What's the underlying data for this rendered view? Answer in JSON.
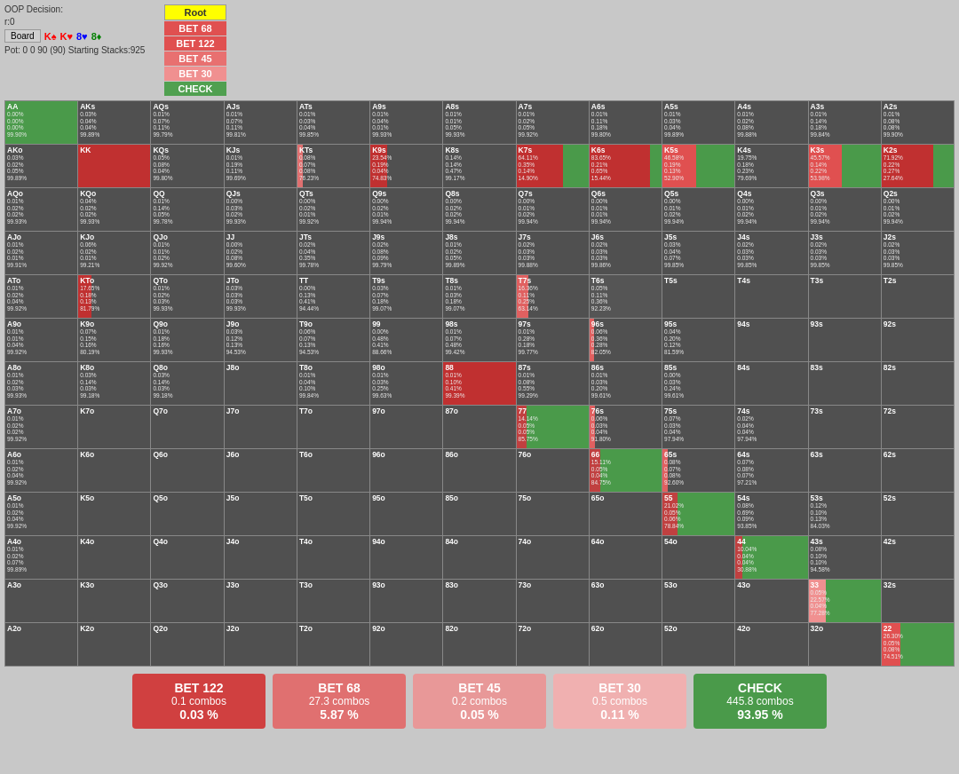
{
  "header": {
    "oop_decision": "OOP Decision:",
    "r": "r:0",
    "board_label": "Board",
    "cards": [
      "K♠",
      "K♥",
      "8♥",
      "8♦"
    ],
    "pot": "Pot: 0 0 90 (90) Starting Stacks:925"
  },
  "actions": [
    {
      "label": "Root",
      "class": "btn-root"
    },
    {
      "label": "BET 68",
      "class": "btn-bet68"
    },
    {
      "label": "BET 122",
      "class": "btn-bet122"
    },
    {
      "label": "BET 45",
      "class": "btn-bet45"
    },
    {
      "label": "BET 30",
      "class": "btn-bet30"
    },
    {
      "label": "CHECK",
      "class": "btn-check"
    }
  ],
  "summary": [
    {
      "label": "BET 122",
      "combos": "0.1 combos",
      "pct": "0.03 %",
      "class": "sum-red"
    },
    {
      "label": "BET 68",
      "combos": "27.3 combos",
      "pct": "5.87 %",
      "class": "sum-pink"
    },
    {
      "label": "BET 45",
      "combos": "0.2 combos",
      "pct": "0.05 %",
      "class": "sum-lpink"
    },
    {
      "label": "BET 30",
      "combos": "0.5 combos",
      "pct": "0.11 %",
      "class": "sum-vlpink"
    },
    {
      "label": "CHECK",
      "combos": "445.8 combos",
      "pct": "93.95 %",
      "class": "sum-green"
    }
  ],
  "grid_rows": [
    [
      "AA",
      "AKs",
      "AQs",
      "AJs",
      "ATs",
      "A9s",
      "A8s",
      "A7s",
      "A6s",
      "A5s",
      "A4s",
      "A3s",
      "A2s"
    ],
    [
      "AKo",
      "KK",
      "KQs",
      "KJs",
      "KTs",
      "K9s",
      "K8s",
      "K7s",
      "K6s",
      "K5s",
      "K4s",
      "K3s",
      "K2s"
    ],
    [
      "AQo",
      "KQo",
      "QQ",
      "QJs",
      "QTs",
      "Q9s",
      "Q8s",
      "Q7s",
      "Q6s",
      "Q5s",
      "Q4s",
      "Q3s",
      "Q2s"
    ],
    [
      "AJo",
      "KJo",
      "QJo",
      "JJ",
      "JTs",
      "J9s",
      "J8s",
      "J7s",
      "J6s",
      "J5s",
      "J4s",
      "J3s",
      "J2s"
    ],
    [
      "ATo",
      "KTo",
      "QTo",
      "JTo",
      "TT",
      "T9s",
      "T8s",
      "T7s",
      "T6s",
      "T5s",
      "T4s",
      "T3s",
      "T2s"
    ],
    [
      "A9o",
      "K9o",
      "Q9o",
      "J9o",
      "T9o",
      "99",
      "98s",
      "97s",
      "96s",
      "95s",
      "94s",
      "93s",
      "92s"
    ],
    [
      "A8o",
      "K8o",
      "Q8o",
      "J8o",
      "T8o",
      "98o",
      "88",
      "87s",
      "86s",
      "85s",
      "84s",
      "83s",
      "82s"
    ],
    [
      "A7o",
      "K7o",
      "Q7o",
      "J7o",
      "T7o",
      "97o",
      "87o",
      "77",
      "76s",
      "75s",
      "74s",
      "73s",
      "72s"
    ],
    [
      "A6o",
      "K6o",
      "Q6o",
      "J6o",
      "T6o",
      "96o",
      "86o",
      "76o",
      "66",
      "65s",
      "64s",
      "63s",
      "62s"
    ],
    [
      "A5o",
      "K5o",
      "Q5o",
      "J5o",
      "T5o",
      "95o",
      "85o",
      "75o",
      "65o",
      "55",
      "54s",
      "53s",
      "52s"
    ],
    [
      "A4o",
      "K4o",
      "Q4o",
      "J4o",
      "T4o",
      "94o",
      "84o",
      "74o",
      "64o",
      "54o",
      "44",
      "43s",
      "42s"
    ],
    [
      "A3o",
      "K3o",
      "Q3o",
      "J3o",
      "T3o",
      "93o",
      "83o",
      "73o",
      "63o",
      "53o",
      "43o",
      "33",
      "32s"
    ],
    [
      "A2o",
      "K2o",
      "Q2o",
      "J2o",
      "T2o",
      "92o",
      "82o",
      "72o",
      "62o",
      "52o",
      "42o",
      "32o",
      "22"
    ]
  ],
  "cell_colors": {
    "AA": "green",
    "AKs": "dark",
    "AQs": "dark",
    "AJs": "dark",
    "ATs": "dark",
    "A9s": "dark",
    "A8s": "dark",
    "A7s": "dark",
    "A6s": "dark",
    "A5s": "dark",
    "A4s": "dark",
    "A3s": "dark",
    "A2s": "dark",
    "AKo": "dark",
    "KK": "red",
    "KQs": "dark",
    "KJs": "dark",
    "KTs": "dark",
    "K9s": "dark",
    "K8s": "dark",
    "K7s": "red",
    "K6s": "red",
    "K5s": "mixed",
    "K4s": "dark",
    "K3s": "dark",
    "K2s": "dark",
    "AQo": "dark",
    "KQo": "dark",
    "QQ": "dark",
    "QJs": "dark",
    "QTs": "dark",
    "Q9s": "dark",
    "Q8s": "dark",
    "Q7s": "dark",
    "Q6s": "dark",
    "Q5s": "dark",
    "Q4s": "dark",
    "Q3s": "dark",
    "Q2s": "dark",
    "AJo": "dark",
    "KJo": "dark",
    "QJo": "dark",
    "JJ": "dark",
    "JTs": "dark",
    "J9s": "dark",
    "J8s": "dark",
    "J7s": "dark",
    "J6s": "dark",
    "J5s": "dark",
    "J4s": "dark",
    "J3s": "dark",
    "J2s": "dark",
    "ATo": "dark",
    "KTo": "red",
    "QTo": "dark",
    "JTo": "dark",
    "TT": "dark",
    "T9s": "dark",
    "T8s": "dark",
    "T7s": "red",
    "T6s": "dark",
    "T5s": "dark",
    "T4s": "dark",
    "T3s": "dark",
    "T2s": "dark",
    "A9o": "dark",
    "K9o": "dark",
    "Q9o": "dark",
    "J9o": "dark",
    "T9o": "dark",
    "99": "dark",
    "98s": "dark",
    "97s": "dark",
    "96s": "dark",
    "95s": "dark",
    "94s": "dark",
    "93s": "dark",
    "92s": "dark",
    "A8o": "dark",
    "K8o": "dark",
    "Q8o": "dark",
    "J8o": "dark",
    "T8o": "dark",
    "98o": "dark",
    "88": "red",
    "87s": "dark",
    "86s": "dark",
    "85s": "dark",
    "84s": "dark",
    "83s": "dark",
    "82s": "dark",
    "A7o": "dark",
    "K7o": "dark",
    "Q7o": "dark",
    "J7o": "dark",
    "T7o": "dark",
    "97o": "dark",
    "87o": "dark",
    "77": "pink",
    "76s": "dark",
    "75s": "dark",
    "74s": "dark",
    "73s": "dark",
    "72s": "dark",
    "A6o": "dark",
    "K6o": "dark",
    "Q6o": "dark",
    "J6o": "dark",
    "T6o": "dark",
    "96o": "dark",
    "86o": "dark",
    "76o": "dark",
    "66": "pink",
    "65s": "dark",
    "64s": "dark",
    "63s": "dark",
    "62s": "dark",
    "A5o": "dark",
    "K5o": "dark",
    "Q5o": "dark",
    "J5o": "dark",
    "T5o": "dark",
    "95o": "dark",
    "85o": "dark",
    "75o": "dark",
    "65o": "dark",
    "55": "pink",
    "54s": "dark",
    "53s": "dark",
    "52s": "dark",
    "A4o": "dark",
    "K4o": "dark",
    "Q4o": "dark",
    "J4o": "dark",
    "T4o": "dark",
    "94o": "dark",
    "84o": "dark",
    "74o": "dark",
    "64o": "dark",
    "54o": "dark",
    "44": "green",
    "43s": "dark",
    "42s": "dark",
    "A3o": "dark",
    "K3o": "dark",
    "Q3o": "dark",
    "J3o": "dark",
    "T3o": "dark",
    "93o": "dark",
    "83o": "dark",
    "73o": "dark",
    "63o": "dark",
    "53o": "dark",
    "43o": "dark",
    "33": "green",
    "32s": "dark",
    "A2o": "dark",
    "K2o": "dark",
    "Q2o": "dark",
    "J2o": "dark",
    "T2o": "dark",
    "92o": "dark",
    "82o": "dark",
    "72o": "dark",
    "62o": "dark",
    "52o": "dark",
    "42o": "dark",
    "32o": "dark",
    "22": "mixed2"
  },
  "cell_data": {
    "AA": [
      "0.00%",
      "0.00%",
      "0.00%",
      "99.90%"
    ],
    "AKs": [
      "0.03%",
      "0.04%",
      "0.04%",
      "99.89%"
    ],
    "AQs": [
      "0.01%",
      "0.07%",
      "0.11%",
      "99.79%"
    ],
    "AJs": [
      "0.01%",
      "0.07%",
      "0.11%",
      "99.81%"
    ],
    "ATs": [
      "0.01%",
      "0.03%",
      "0.04%",
      "99.85%"
    ],
    "A9s": [
      "0.01%",
      "0.04%",
      "0.01%",
      "99.93%"
    ],
    "A8s": [
      "0.01%",
      "0.01%",
      "0.05%",
      "99.93%"
    ],
    "A7s": [
      "0.01%",
      "0.02%",
      "0.05%",
      "99.92%"
    ],
    "A6s": [
      "0.01%",
      "0.11%",
      "0.18%",
      "99.80%"
    ],
    "A5s": [
      "0.01%",
      "0.03%",
      "0.04%",
      "99.89%"
    ],
    "A4s": [
      "0.01%",
      "0.02%",
      "0.08%",
      "99.88%"
    ],
    "A3s": [
      "0.01%",
      "0.14%",
      "0.18%",
      "99.84%"
    ],
    "A2s": [
      "0.01%",
      "0.08%",
      "0.08%",
      "99.90%"
    ],
    "AKo": [
      "0.03%",
      "0.02%",
      "0.05%",
      "99.89%"
    ],
    "KK": [
      "",
      "",
      "",
      ""
    ],
    "KQs": [
      "0.05%",
      "0.08%",
      "0.04%",
      "99.80%"
    ],
    "KJs": [
      "0.01%",
      "0.19%",
      "0.11%",
      "99.69%"
    ],
    "KTs": [
      "0.08%",
      "0.07%",
      "0.08%",
      "76.23%"
    ],
    "K9s": [
      "23.54%",
      "0.19%",
      "0.04%",
      "74.83%"
    ],
    "K8s": [
      "0.14%",
      "0.14%",
      "0.47%",
      "99.17%"
    ],
    "K7s": [
      "64.11%",
      "0.35%",
      "0.14%",
      "14.90%"
    ],
    "K6s": [
      "83.65%",
      "0.21%",
      "0.65%",
      "15.44%"
    ],
    "K5s": [
      "46.58%",
      "0.19%",
      "0.13%",
      "52.90%"
    ],
    "K4s": [
      "19.75%",
      "0.18%",
      "0.23%",
      "79.69%"
    ],
    "K3s": [
      "45.57%",
      "0.14%",
      "0.22%",
      "53.98%"
    ],
    "K2s": [
      "71.92%",
      "0.22%",
      "0.27%",
      "27.64%"
    ],
    "AQo": [
      "0.01%",
      "0.02%",
      "0.02%",
      "99.93%"
    ],
    "KQo": [
      "0.04%",
      "0.02%",
      "0.02%",
      "99.93%"
    ],
    "QQ": [
      "0.01%",
      "0.14%",
      "0.05%",
      "99.78%"
    ],
    "QJs": [
      "0.00%",
      "0.03%",
      "0.02%",
      "99.93%"
    ],
    "QTs": [
      "0.00%",
      "0.02%",
      "0.01%",
      "99.92%"
    ],
    "Q9s": [
      "0.00%",
      "0.02%",
      "0.01%",
      "99.94%"
    ],
    "Q8s": [
      "0.00%",
      "0.02%",
      "0.02%",
      "99.94%"
    ],
    "Q7s": [
      "0.00%",
      "0.01%",
      "0.02%",
      "99.94%"
    ],
    "Q6s": [
      "0.00%",
      "0.01%",
      "0.01%",
      "99.94%"
    ],
    "Q5s": [
      "0.00%",
      "0.01%",
      "0.02%",
      "99.94%"
    ],
    "Q4s": [
      "0.00%",
      "0.01%",
      "0.02%",
      "99.94%"
    ],
    "Q3s": [
      "0.00%",
      "0.01%",
      "0.02%",
      "99.94%"
    ],
    "Q2s": [
      "0.00%",
      "0.01%",
      "0.02%",
      "99.94%"
    ],
    "AJo": [
      "0.01%",
      "0.02%",
      "0.01%",
      "99.91%"
    ],
    "KJo": [
      "0.06%",
      "0.02%",
      "0.01%",
      "99.21%"
    ],
    "QJo": [
      "0.01%",
      "0.01%",
      "0.02%",
      "99.92%"
    ],
    "JJ": [
      "0.00%",
      "0.02%",
      "0.08%",
      "99.60%"
    ],
    "JTs": [
      "0.02%",
      "0.04%",
      "0.35%",
      "99.78%"
    ],
    "J9s": [
      "0.02%",
      "0.08%",
      "0.09%",
      "99.79%"
    ],
    "J8s": [
      "0.01%",
      "0.02%",
      "0.05%",
      "99.89%"
    ],
    "J7s": [
      "0.02%",
      "0.03%",
      "0.03%",
      "99.88%"
    ],
    "J6s": [
      "0.02%",
      "0.03%",
      "0.03%",
      "99.86%"
    ],
    "J5s": [
      "0.03%",
      "0.04%",
      "0.07%",
      "99.85%"
    ],
    "J4s": [
      "0.02%",
      "0.03%",
      "0.03%",
      "99.85%"
    ],
    "J3s": [
      "0.02%",
      "0.03%",
      "0.03%",
      "99.85%"
    ],
    "J2s": [
      "0.02%",
      "0.03%",
      "0.03%",
      "99.85%"
    ],
    "ATo": [
      "0.01%",
      "0.02%",
      "0.04%",
      "99.92%"
    ],
    "KTo": [
      "17.65%",
      "0.18%",
      "0.13%",
      "81.79%"
    ],
    "QTo": [
      "0.01%",
      "0.02%",
      "0.03%",
      "99.93%"
    ],
    "JTo": [
      "0.03%",
      "0.03%",
      "0.03%",
      "99.93%"
    ],
    "TT": [
      "0.00%",
      "0.13%",
      "0.41%",
      "94.44%"
    ],
    "T9s": [
      "0.03%",
      "0.07%",
      "0.18%",
      "99.07%"
    ],
    "T8s": [
      "0.01%",
      "0.03%",
      "0.18%",
      "99.07%"
    ],
    "T7s": [
      "16.36%",
      "0.11%",
      "0.25%",
      "63.14%"
    ],
    "T6s": [
      "0.05%",
      "0.11%",
      "0.36%",
      "92.23%"
    ],
    "T5s": [
      "",
      "",
      "",
      ""
    ],
    "T4s": [
      "",
      "",
      "",
      ""
    ],
    "T3s": [
      "",
      "",
      "",
      ""
    ],
    "T2s": [
      "",
      "",
      "",
      ""
    ],
    "A9o": [
      "0.01%",
      "0.01%",
      "0.04%",
      "99.92%"
    ],
    "K9o": [
      "0.07%",
      "0.15%",
      "0.16%",
      "80.19%"
    ],
    "Q9o": [
      "0.01%",
      "0.18%",
      "0.16%",
      "99.93%"
    ],
    "J9o": [
      "0.03%",
      "0.12%",
      "0.13%",
      "94.53%"
    ],
    "T9o": [
      "0.06%",
      "0.07%",
      "0.13%",
      "94.53%"
    ],
    "99": [
      "0.00%",
      "0.48%",
      "0.41%",
      "88.66%"
    ],
    "98s": [
      "0.01%",
      "0.07%",
      "0.48%",
      "99.42%"
    ],
    "97s": [
      "0.01%",
      "0.28%",
      "0.18%",
      "99.77%"
    ],
    "96s": [
      "0.06%",
      "0.36%",
      "0.28%",
      "82.05%"
    ],
    "95s": [
      "0.04%",
      "0.20%",
      "0.12%",
      "81.59%"
    ],
    "94s": [
      "",
      "",
      "",
      ""
    ],
    "93s": [
      "",
      "",
      "",
      ""
    ],
    "92s": [
      "",
      "",
      "",
      ""
    ],
    "A8o": [
      "0.01%",
      "0.02%",
      "0.03%",
      "99.93%"
    ],
    "K8o": [
      "0.03%",
      "0.14%",
      "0.03%",
      "99.18%"
    ],
    "Q8o": [
      "0.03%",
      "0.14%",
      "0.03%",
      "99.18%"
    ],
    "J8o": [
      "",
      "",
      "",
      ""
    ],
    "T8o": [
      "0.01%",
      "0.04%",
      "0.10%",
      "99.84%"
    ],
    "98o": [
      "0.01%",
      "0.03%",
      "0.25%",
      "99.63%"
    ],
    "88": [
      "0.01%",
      "0.10%",
      "0.41%",
      "99.39%"
    ],
    "87s": [
      "0.01%",
      "0.08%",
      "0.55%",
      "99.29%"
    ],
    "86s": [
      "0.01%",
      "0.03%",
      "0.20%",
      "99.61%"
    ],
    "85s": [
      "0.00%",
      "0.03%",
      "0.24%",
      "99.61%"
    ],
    "84s": [
      "",
      "",
      "",
      ""
    ],
    "83s": [
      "",
      "",
      "",
      ""
    ],
    "82s": [
      "",
      "",
      "",
      ""
    ],
    "A7o": [
      "0.01%",
      "0.02%",
      "0.02%",
      "99.92%"
    ],
    "K7o": [
      "",
      "",
      "",
      ""
    ],
    "Q7o": [
      "",
      "",
      "",
      ""
    ],
    "J7o": [
      "",
      "",
      "",
      ""
    ],
    "T7o": [
      "",
      "",
      "",
      ""
    ],
    "97o": [
      "",
      "",
      "",
      ""
    ],
    "87o": [
      "",
      "",
      "",
      ""
    ],
    "77": [
      "14.14%",
      "0.05%",
      "0.05%",
      "85.75%"
    ],
    "76s": [
      "0.06%",
      "0.03%",
      "0.04%",
      "91.80%"
    ],
    "75s": [
      "0.07%",
      "0.03%",
      "0.04%",
      "97.94%"
    ],
    "74s": [
      "0.02%",
      "0.04%",
      "0.04%",
      "97.94%"
    ],
    "73s": [
      "",
      "",
      "",
      ""
    ],
    "72s": [
      "",
      "",
      "",
      ""
    ],
    "A6o": [
      "0.01%",
      "0.02%",
      "0.04%",
      "99.92%"
    ],
    "K6o": [
      "",
      "",
      "",
      ""
    ],
    "Q6o": [
      "",
      "",
      "",
      ""
    ],
    "J6o": [
      "",
      "",
      "",
      ""
    ],
    "T6o": [
      "",
      "",
      "",
      ""
    ],
    "96o": [
      "",
      "",
      "",
      ""
    ],
    "86o": [
      "",
      "",
      "",
      ""
    ],
    "76o": [
      "",
      "",
      "",
      ""
    ],
    "66": [
      "15.11%",
      "0.05%",
      "0.04%",
      "84.75%"
    ],
    "65s": [
      "0.08%",
      "0.07%",
      "0.08%",
      "92.60%"
    ],
    "64s": [
      "0.07%",
      "0.08%",
      "0.07%",
      "97.21%"
    ],
    "63s": [
      "",
      "",
      "",
      ""
    ],
    "62s": [
      "",
      "",
      "",
      ""
    ],
    "A5o": [
      "0.01%",
      "0.02%",
      "0.04%",
      "99.92%"
    ],
    "K5o": [
      "",
      "",
      "",
      ""
    ],
    "Q5o": [
      "",
      "",
      "",
      ""
    ],
    "J5o": [
      "",
      "",
      "",
      ""
    ],
    "T5o": [
      "",
      "",
      "",
      ""
    ],
    "95o": [
      "",
      "",
      "",
      ""
    ],
    "85o": [
      "",
      "",
      "",
      ""
    ],
    "75o": [
      "",
      "",
      "",
      ""
    ],
    "65o": [
      "",
      "",
      "",
      ""
    ],
    "55": [
      "21.02%",
      "0.05%",
      "0.06%",
      "78.84%"
    ],
    "54s": [
      "0.08%",
      "0.69%",
      "0.09%",
      "93.85%"
    ],
    "53s": [
      "0.12%",
      "0.10%",
      "0.13%",
      "84.03%"
    ],
    "52s": [
      "",
      "",
      "",
      ""
    ],
    "A4o": [
      "0.01%",
      "0.02%",
      "0.07%",
      "99.89%"
    ],
    "K4o": [
      "",
      "",
      "",
      ""
    ],
    "Q4o": [
      "",
      "",
      "",
      ""
    ],
    "J4o": [
      "",
      "",
      "",
      ""
    ],
    "T4o": [
      "",
      "",
      "",
      ""
    ],
    "94o": [
      "",
      "",
      "",
      ""
    ],
    "84o": [
      "",
      "",
      "",
      ""
    ],
    "74o": [
      "",
      "",
      "",
      ""
    ],
    "64o": [
      "",
      "",
      "",
      ""
    ],
    "54o": [
      "",
      "",
      "",
      ""
    ],
    "44": [
      "10.04%",
      "0.04%",
      "0.04%",
      "30.88%"
    ],
    "43s": [
      "0.08%",
      "0.10%",
      "0.10%",
      "94.58%"
    ],
    "42s": [
      "",
      "",
      "",
      ""
    ],
    "A3o": [
      "",
      "",
      "",
      ""
    ],
    "K3o": [
      "",
      "",
      "",
      ""
    ],
    "Q3o": [
      "",
      "",
      "",
      ""
    ],
    "J3o": [
      "",
      "",
      "",
      ""
    ],
    "T3o": [
      "",
      "",
      "",
      ""
    ],
    "93o": [
      "",
      "",
      "",
      ""
    ],
    "83o": [
      "",
      "",
      "",
      ""
    ],
    "73o": [
      "",
      "",
      "",
      ""
    ],
    "63o": [
      "",
      "",
      "",
      ""
    ],
    "53o": [
      "",
      "",
      "",
      ""
    ],
    "43o": [
      "",
      "",
      "",
      ""
    ],
    "33": [
      "0.05%",
      "22.57%",
      "0.04%",
      "77.28%"
    ],
    "32s": [
      "",
      "",
      "",
      ""
    ],
    "A2o": [
      "",
      "",
      "",
      ""
    ],
    "K2o": [
      "",
      "",
      "",
      ""
    ],
    "Q2o": [
      "",
      "",
      "",
      ""
    ],
    "J2o": [
      "",
      "",
      "",
      ""
    ],
    "T2o": [
      "",
      "",
      "",
      ""
    ],
    "92o": [
      "",
      "",
      "",
      ""
    ],
    "82o": [
      "",
      "",
      "",
      ""
    ],
    "72o": [
      "",
      "",
      "",
      ""
    ],
    "62o": [
      "",
      "",
      "",
      ""
    ],
    "52o": [
      "",
      "",
      "",
      ""
    ],
    "42o": [
      "",
      "",
      "",
      ""
    ],
    "32o": [
      "",
      "",
      "",
      ""
    ],
    "22": [
      "26.30%",
      "0.05%",
      "0.08%",
      "74.51%"
    ]
  }
}
